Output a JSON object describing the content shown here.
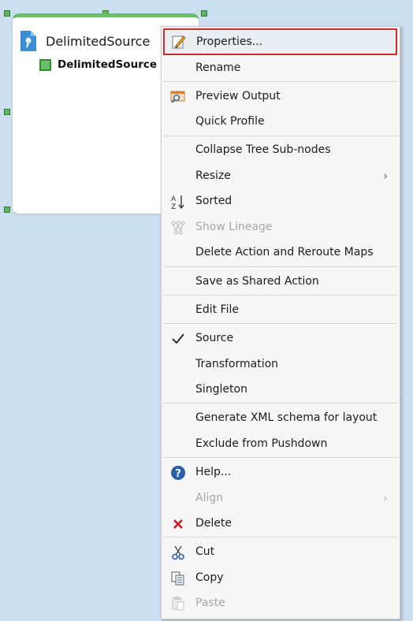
{
  "node": {
    "title": "DelimitedSource",
    "port_label": "DelimitedSource",
    "accent_color": "#6abf6a"
  },
  "menu": {
    "items": [
      {
        "label": "Properties...",
        "icon": "edit-properties-icon",
        "highlighted": true
      },
      {
        "label": "Rename"
      },
      {
        "label": "Preview Output",
        "icon": "preview-output-icon"
      },
      {
        "label": "Quick Profile"
      },
      {
        "label": "Collapse Tree Sub-nodes"
      },
      {
        "label": "Resize",
        "submenu": true
      },
      {
        "label": "Sorted",
        "icon": "sort-az-icon"
      },
      {
        "label": "Show Lineage",
        "icon": "lineage-icon",
        "disabled": true
      },
      {
        "label": "Delete Action and Reroute Maps"
      },
      {
        "label": "Save as Shared Action"
      },
      {
        "label": "Edit File"
      },
      {
        "label": "Source",
        "icon": "checkmark-icon",
        "checked": true
      },
      {
        "label": "Transformation"
      },
      {
        "label": "Singleton"
      },
      {
        "label": "Generate XML schema for layout"
      },
      {
        "label": "Exclude from Pushdown"
      },
      {
        "label": "Help...",
        "icon": "help-icon"
      },
      {
        "label": "Align",
        "submenu": true,
        "disabled": true
      },
      {
        "label": "Delete",
        "icon": "delete-x-icon"
      },
      {
        "label": "Cut",
        "icon": "scissors-icon"
      },
      {
        "label": "Copy",
        "icon": "copy-icon"
      },
      {
        "label": "Paste",
        "icon": "paste-icon",
        "disabled": true
      }
    ],
    "submenu_glyph": "›",
    "highlight_border_color": "#d42a2a"
  }
}
